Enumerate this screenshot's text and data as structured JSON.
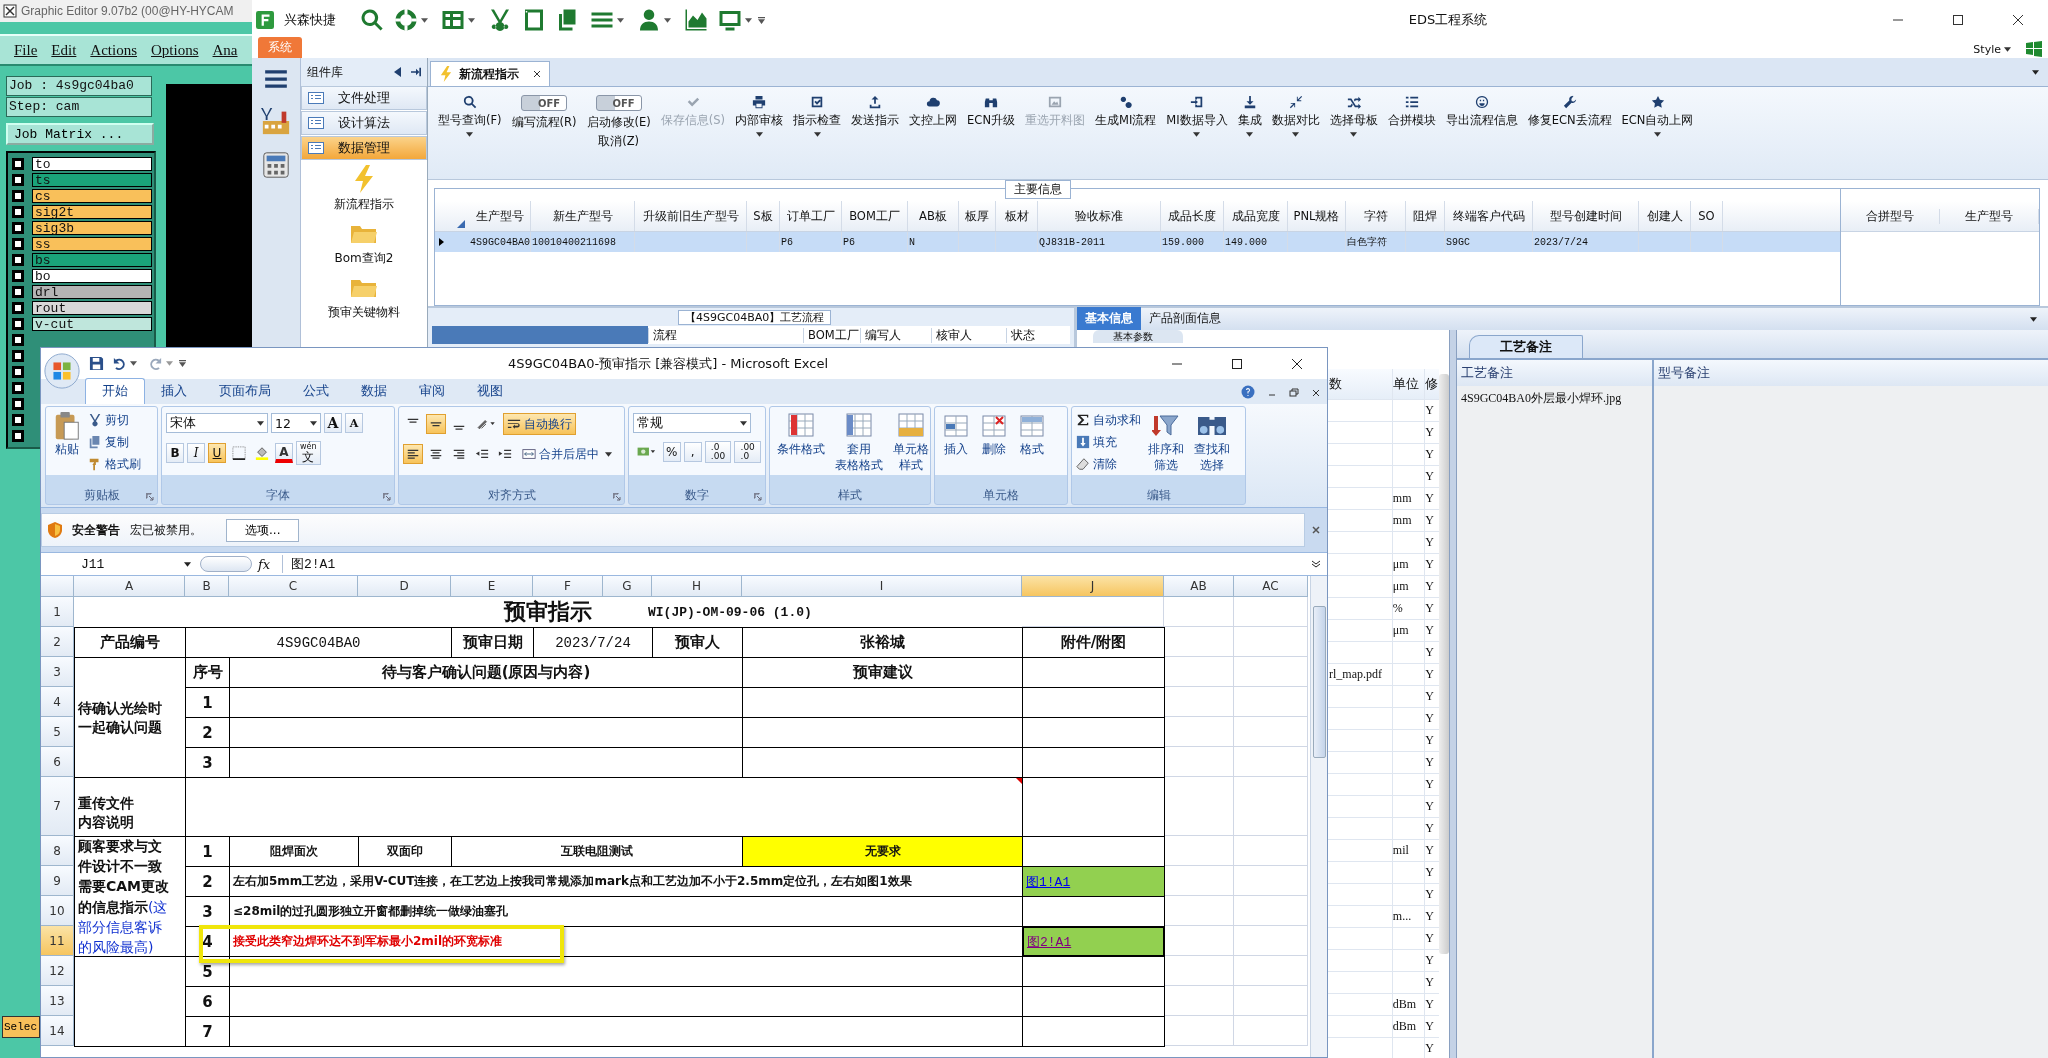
{
  "graphic_editor": {
    "title": "Graphic Editor 9.07b2 (00@HY-HYCAM",
    "menu": [
      "File",
      "Edit",
      "Actions",
      "Options",
      "Ana"
    ],
    "job": "Job : 4s9gc04ba0",
    "step": "Step: cam",
    "matrix_button": "Job Matrix ...",
    "select_button": "Selec",
    "layers": [
      {
        "name": "to",
        "color": "#ffffff",
        "checked": false
      },
      {
        "name": "ts",
        "color": "#1aa37a",
        "checked": false
      },
      {
        "name": "cs",
        "color": "#f9c05a",
        "checked": false
      },
      {
        "name": "sig2t",
        "color": "#f9c05a",
        "checked": false
      },
      {
        "name": "sig3b",
        "color": "#f9c05a",
        "checked": false
      },
      {
        "name": "ss",
        "color": "#f9c05a",
        "checked": false
      },
      {
        "name": "bs",
        "color": "#1aa37a",
        "checked": false
      },
      {
        "name": "bo",
        "color": "#ffffff",
        "checked": false
      },
      {
        "name": "drl",
        "color": "#b4b4b4",
        "checked": false
      },
      {
        "name": "rout",
        "color": "#d8d8d8",
        "checked": false
      },
      {
        "name": "v-cut",
        "color": "#bfe6dc",
        "checked": false
      },
      {
        "checked": false
      },
      {
        "checked": false
      },
      {
        "checked": false
      },
      {
        "checked": false
      },
      {
        "checked": false
      },
      {
        "checked": false
      },
      {
        "checked": false
      }
    ]
  },
  "eds": {
    "brand": "兴森快捷",
    "title": "EDS工程系统",
    "system_tab": "系统",
    "style_menu": "Style",
    "library": {
      "title": "组件库",
      "items": [
        {
          "label": "文件处理",
          "selected": false
        },
        {
          "label": "设计算法",
          "selected": false
        },
        {
          "label": "数据管理",
          "selected": true
        }
      ],
      "tools": [
        {
          "label": "新流程指示"
        },
        {
          "label": "Bom查询2"
        },
        {
          "label": "预审关键物料"
        }
      ]
    },
    "doc_tab": "新流程指示",
    "toolbar": [
      {
        "kind": "button",
        "label": "型号查询(F)",
        "disabled": false,
        "dropdown": true
      },
      {
        "kind": "toggle",
        "label": "编写流程(R)",
        "switch_text": "OFF",
        "on": false
      },
      {
        "kind": "toggle",
        "label": "启动修改(E)",
        "label2": "取消(Z)",
        "switch_text": "OFF",
        "on": false
      },
      {
        "kind": "button",
        "label": "保存信息(S)",
        "disabled": true,
        "dropdown": false
      },
      {
        "kind": "button",
        "label": "内部审核",
        "disabled": false,
        "dropdown": true
      },
      {
        "kind": "button",
        "label": "指示检查",
        "disabled": false,
        "dropdown": true
      },
      {
        "kind": "button",
        "label": "发送指示",
        "disabled": false,
        "dropdown": false
      },
      {
        "kind": "button",
        "label": "文控上网",
        "disabled": false,
        "dropdown": false
      },
      {
        "kind": "button",
        "label": "ECN升级",
        "disabled": false,
        "dropdown": false
      },
      {
        "kind": "button",
        "label": "重选开料图",
        "disabled": true,
        "dropdown": false
      },
      {
        "kind": "button",
        "label": "生成MI流程",
        "disabled": false,
        "dropdown": false
      },
      {
        "kind": "button",
        "label": "MI数据导入",
        "disabled": false,
        "dropdown": true
      },
      {
        "kind": "button",
        "label": "集成",
        "disabled": false,
        "dropdown": true
      },
      {
        "kind": "button",
        "label": "数据对比",
        "disabled": false,
        "dropdown": true
      },
      {
        "kind": "button",
        "label": "选择母板",
        "disabled": false,
        "dropdown": true
      },
      {
        "kind": "button",
        "label": "合拼模块",
        "disabled": false,
        "dropdown": false
      },
      {
        "kind": "button",
        "label": "导出流程信息",
        "disabled": false,
        "dropdown": false
      },
      {
        "kind": "button",
        "label": "修复ECN丢流程",
        "disabled": false,
        "dropdown": false
      },
      {
        "kind": "button",
        "label": "ECN自动上网",
        "disabled": false,
        "dropdown": true
      }
    ],
    "main_info": {
      "title": "主要信息",
      "columns": [
        "生产型号",
        "新生产型号",
        "升级前旧生产型号",
        "S板",
        "订单工厂",
        "BOM工厂",
        "AB板",
        "板厚",
        "板材",
        "验收标准",
        "成品长度",
        "成品宽度",
        "PNL规格",
        "字符",
        "阻焊",
        "终端客户代码",
        "型号创建时间",
        "创建人",
        "SO"
      ],
      "rows": [
        {
          "selected": true,
          "cells": [
            "4S9GC04BA0",
            "10010400211698",
            null,
            null,
            "P6",
            "P6",
            "N",
            null,
            null,
            "QJ831B-2011",
            "159.000",
            "149.000",
            null,
            "白色字符",
            null,
            "S9GC",
            "2023/7/24",
            null,
            null
          ]
        }
      ],
      "side_columns": [
        "合拼型号",
        "生产型号"
      ]
    },
    "process_flow": {
      "title": "【4S9GC04BA0】工艺流程",
      "columns": [
        "流程",
        "BOM工厂",
        "编写人",
        "核审人",
        "状态"
      ]
    },
    "info_tabs": [
      {
        "label": "基本信息",
        "selected": true
      },
      {
        "label": "产品剖面信息",
        "selected": false
      }
    ],
    "sub_tab": "基本参数",
    "params": {
      "columns": [
        "数",
        "单位",
        "修"
      ],
      "rows": [
        {
          "flag": "Y"
        },
        {
          "flag": "Y"
        },
        {
          "flag": "Y"
        },
        {
          "flag": "Y"
        },
        {
          "unit": "mm",
          "flag": "Y"
        },
        {
          "unit": "mm",
          "flag": "Y"
        },
        {
          "flag": "Y"
        },
        {
          "unit": "μm",
          "flag": "Y"
        },
        {
          "unit": "μm",
          "flag": "Y"
        },
        {
          "unit": "%",
          "flag": "Y"
        },
        {
          "unit": "μm",
          "flag": "Y"
        },
        {
          "flag": "Y"
        },
        {
          "value": "rl_map.pdf",
          "flag": "Y"
        },
        {
          "flag": "Y"
        },
        {
          "flag": "Y"
        },
        {
          "flag": "Y"
        },
        {
          "flag": "Y"
        },
        {
          "flag": "Y"
        },
        {
          "flag": "Y"
        },
        {
          "flag": "Y"
        },
        {
          "unit": "mil",
          "flag": "Y"
        },
        {
          "flag": "Y"
        },
        {
          "flag": "Y"
        },
        {
          "unit": "m...",
          "flag": "Y"
        },
        {
          "flag": "Y"
        },
        {
          "flag": "Y"
        },
        {
          "flag": "Y"
        },
        {
          "unit": "dBm",
          "flag": "Y"
        },
        {
          "unit": "dBm",
          "flag": "Y"
        },
        {
          "flag": "Y"
        }
      ]
    },
    "remarks": {
      "tab": "工艺备注",
      "columns": [
        "工艺备注",
        "型号备注"
      ],
      "cell": "4S9GC04BA0外层最小焊环.jpg"
    }
  },
  "excel": {
    "title": "4S9GC04BA0-预审指示  [兼容模式] - Microsoft Excel",
    "tabs": [
      {
        "label": "开始",
        "selected": true
      },
      {
        "label": "插入",
        "selected": false
      },
      {
        "label": "页面布局",
        "selected": false
      },
      {
        "label": "公式",
        "selected": false
      },
      {
        "label": "数据",
        "selected": false
      },
      {
        "label": "审阅",
        "selected": false
      },
      {
        "label": "视图",
        "selected": false
      }
    ],
    "clipboard": {
      "paste": "粘贴",
      "cut": "剪切",
      "copy": "复制",
      "painter": "格式刷",
      "label": "剪贴板"
    },
    "font": {
      "name": "宋体",
      "size": "12",
      "grow": "A",
      "shrink": "A",
      "color_letter": "A",
      "phonetic_top": "wén",
      "phonetic": "文",
      "label": "字体",
      "styles": [
        {
          "text": "B",
          "selected": false
        },
        {
          "text": "I",
          "selected": false
        },
        {
          "text": "U",
          "selected": true
        }
      ]
    },
    "alignment": {
      "vertical": [
        {
          "selected": false
        },
        {
          "selected": true
        },
        {
          "selected": false
        }
      ],
      "horizontal": [
        {
          "selected": true
        },
        {
          "selected": false
        },
        {
          "selected": false
        }
      ],
      "wrap": {
        "label": "自动换行",
        "selected": true
      },
      "merge": "合并后居中",
      "label": "对齐方式"
    },
    "number": {
      "format": "常规",
      "percent": "%",
      "comma": ",",
      "inc_decimal": ".0\n.00",
      "dec_decimal": ".00\n.0",
      "label": "数字"
    },
    "styles": {
      "buttons": [
        [
          "条件格式"
        ],
        [
          "套用",
          "表格格式"
        ],
        [
          "单元格",
          "样式"
        ]
      ],
      "label": "样式"
    },
    "cells_group": {
      "buttons": [
        "插入",
        "删除",
        "格式"
      ],
      "label": "单元格"
    },
    "editing": {
      "autosum": "自动求和",
      "fill": "填充",
      "clear": "清除",
      "sort": [
        "排序和",
        "筛选"
      ],
      "find": [
        "查找和",
        "选择"
      ],
      "label": "编辑"
    },
    "security": {
      "title": "安全警告",
      "message": "宏已被禁用。",
      "button": "选项..."
    },
    "formula_bar": {
      "name_box": "J11",
      "fx": "fx",
      "formula": "图2!A1"
    },
    "columns": [
      {
        "label": "A",
        "selected": false
      },
      {
        "label": "B",
        "selected": false
      },
      {
        "label": "C",
        "selected": false
      },
      {
        "label": "D",
        "selected": false
      },
      {
        "label": "E",
        "selected": false
      },
      {
        "label": "F",
        "selected": false
      },
      {
        "label": "G",
        "selected": false
      },
      {
        "label": "H",
        "selected": false
      },
      {
        "label": "I",
        "selected": false
      },
      {
        "label": "J",
        "selected": true
      },
      {
        "label": "AB",
        "selected": false
      },
      {
        "label": "AC",
        "selected": false
      }
    ],
    "rows": [
      {
        "label": "1",
        "selected": false
      },
      {
        "label": "2",
        "selected": false
      },
      {
        "label": "3",
        "selected": false
      },
      {
        "label": "4",
        "selected": false
      },
      {
        "label": "5",
        "selected": false
      },
      {
        "label": "6",
        "selected": false
      },
      {
        "label": "7",
        "selected": false
      },
      {
        "label": "8",
        "selected": false
      },
      {
        "label": "9",
        "selected": false
      },
      {
        "label": "10",
        "selected": false
      },
      {
        "label": "11",
        "selected": true
      },
      {
        "label": "12",
        "selected": false
      },
      {
        "label": "13",
        "selected": false
      },
      {
        "label": "14",
        "selected": false
      }
    ],
    "cells": [
      {
        "kind": "title",
        "text": "预审指示",
        "subtext": "WI(JP)-OM-09-06 (1.0)",
        "selected": false
      },
      {
        "kind": "header",
        "text": "产品编号",
        "selected": false
      },
      {
        "kind": "value",
        "text": "4S9GC04BA0",
        "selected": false
      },
      {
        "kind": "header",
        "text": "预审日期",
        "selected": false
      },
      {
        "kind": "value",
        "text": "2023/7/24",
        "selected": false
      },
      {
        "kind": "header",
        "text": "预审人",
        "selected": false
      },
      {
        "kind": "header",
        "text": "张裕城",
        "selected": false
      },
      {
        "kind": "header",
        "text": "附件/附图",
        "selected": false
      },
      {
        "kind": "label",
        "text": "待确认光绘时一起确认问题",
        "selected": false
      },
      {
        "kind": "header",
        "text": "序号",
        "selected": false
      },
      {
        "kind": "header",
        "text": "待与客户确认问题(原因与内容)",
        "selected": false
      },
      {
        "kind": "header",
        "text": "预审建议",
        "selected": false
      },
      {
        "kind": "header",
        "text": "1",
        "selected": false
      },
      {
        "kind": "header",
        "text": "2",
        "selected": false
      },
      {
        "kind": "header",
        "text": "3",
        "selected": false
      },
      {
        "kind": "label_short",
        "text": "重传文件内容说明",
        "selected": false
      },
      {
        "kind": "note",
        "text": "**顾客要求与文件设计不一致需要CAM更改的信息指示**(这部分信息客诉的风险最高)",
        "selected": false
      },
      {
        "kind": "header",
        "text": "1",
        "selected": false
      },
      {
        "kind": "small",
        "text": "阻焊面次",
        "selected": false
      },
      {
        "kind": "small",
        "text": "双面印",
        "selected": false
      },
      {
        "kind": "small",
        "text": "互联电阻测试",
        "selected": false
      },
      {
        "kind": "highlight",
        "text": "无要求",
        "selected": false
      },
      {
        "kind": "header",
        "text": "2",
        "selected": false
      },
      {
        "kind": "instruction",
        "text": "左右加5mm工艺边，采用V-CUT连接，在工艺边上按我司常规添加mark点和工艺边加不小于2.5mm定位孔，左右如图1效果",
        "selected": false
      },
      {
        "kind": "link",
        "text": "图1!A1",
        "selected": false
      },
      {
        "kind": "header",
        "text": "3",
        "selected": false
      },
      {
        "kind": "instruction",
        "text": "≤28mil的过孔圆形独立开窗都删掉统一做绿油塞孔",
        "selected": false
      },
      {
        "kind": "header",
        "text": "4",
        "selected": false
      },
      {
        "kind": "alert",
        "text": "接受此类窄边焊环达不到军标最小2mil的环宽标准",
        "selected": false
      },
      {
        "kind": "visited_link",
        "text": "图2!A1",
        "selected": true
      },
      {
        "kind": "header",
        "text": "5",
        "selected": false
      },
      {
        "kind": "header",
        "text": "6",
        "selected": false
      },
      {
        "kind": "header",
        "text": "7",
        "selected": false
      },
      {
        "kind": "commented",
        "selected": false
      }
    ]
  }
}
